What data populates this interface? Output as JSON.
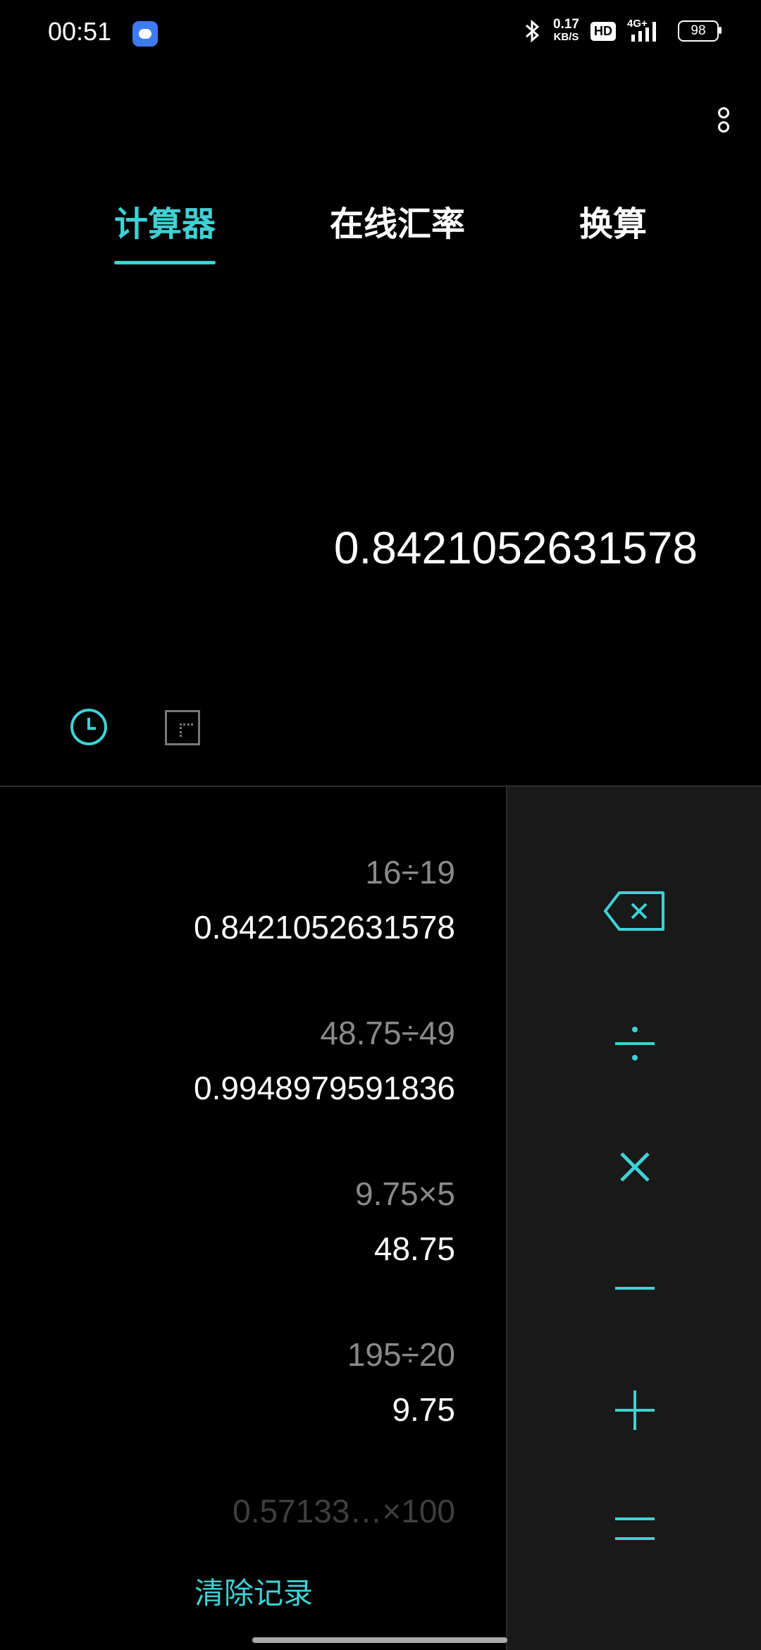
{
  "status_bar": {
    "time": "00:51",
    "net_speed_value": "0.17",
    "net_speed_unit": "KB/S",
    "hd": "HD",
    "network": "4G+",
    "battery": "98"
  },
  "tabs": [
    {
      "label": "计算器",
      "active": true
    },
    {
      "label": "在线汇率",
      "active": false
    },
    {
      "label": "换算",
      "active": false
    }
  ],
  "display": {
    "value": "0.8421052631578"
  },
  "history": [
    {
      "expression": "16÷19",
      "result": "0.8421052631578"
    },
    {
      "expression": "48.75÷49",
      "result": "0.9948979591836"
    },
    {
      "expression": "9.75×5",
      "result": "48.75"
    },
    {
      "expression": "195÷20",
      "result": "9.75"
    },
    {
      "expression": "0.57133…×100",
      "result": ""
    }
  ],
  "clear_history_label": "清除记录",
  "operators": {
    "divide": "÷",
    "multiply": "×",
    "minus": "−",
    "plus": "+",
    "equals": "="
  },
  "colors": {
    "accent": "#3fd1d5",
    "background": "#000000",
    "operator_panel": "#191919",
    "history_expression": "#8a8a8a"
  }
}
